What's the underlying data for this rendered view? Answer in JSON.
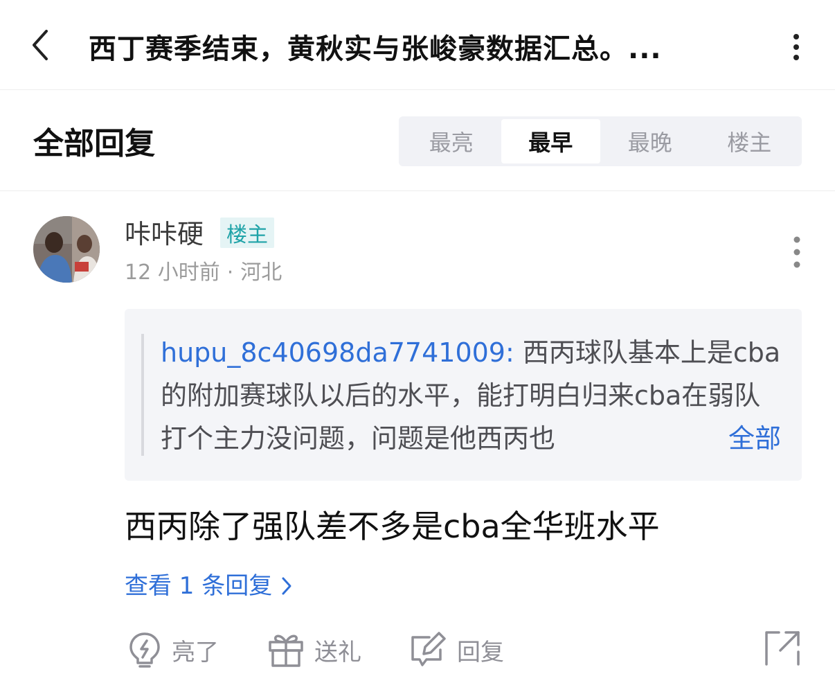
{
  "header": {
    "back_icon": "chevron-left-icon",
    "title": "西丁赛季结束，黄秋实与张峻豪数据汇总。...",
    "more_icon": "vertical-dots-icon"
  },
  "replies": {
    "title": "全部回复",
    "tabs": [
      {
        "label": "最亮",
        "active": false
      },
      {
        "label": "最早",
        "active": true
      },
      {
        "label": "最晚",
        "active": false
      },
      {
        "label": "楼主",
        "active": false
      }
    ]
  },
  "comment": {
    "username": "咔咔硬",
    "badge": "楼主",
    "time": "12 小时前",
    "separator": "·",
    "location": "河北",
    "quote": {
      "user": "hupu_8c40698da7741009:",
      "text": " 西丙球队基本上是cba的附加赛球队以后的水平，能打明白归来cba在弱队打个主力没问题，问题是他西丙也",
      "more_label": "全部"
    },
    "body": "西丙除了强队差不多是cba全华班水平",
    "view_replies": "查看 1 条回复",
    "actions": {
      "like_label": "亮了",
      "gift_label": "送礼",
      "reply_label": "回复"
    }
  },
  "colors": {
    "accent_blue": "#2f6fd8",
    "badge_teal": "#1fa3a8",
    "badge_bg": "#e5f4f5",
    "muted_gray": "#9b9b9b",
    "tab_bg": "#f1f2f6",
    "quote_bg": "#f4f5f8"
  }
}
